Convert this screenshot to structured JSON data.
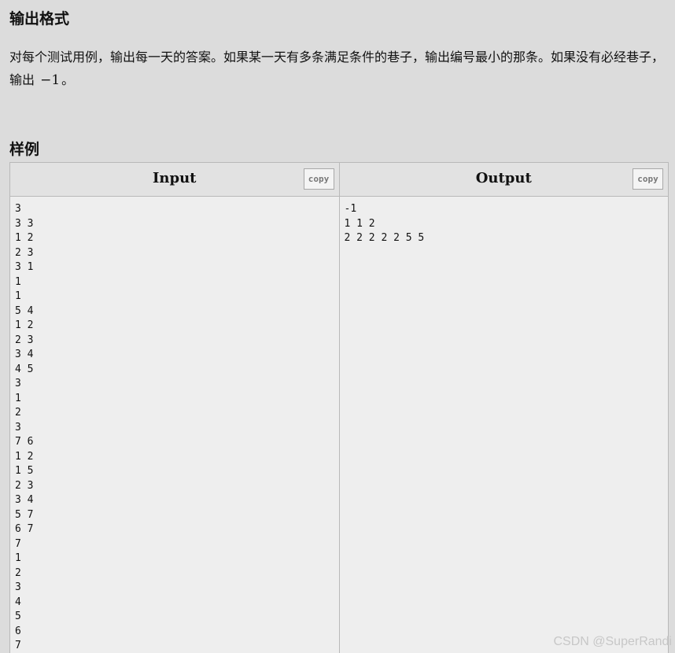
{
  "output_format": {
    "title": "输出格式",
    "desc_before": "对每个测试用例，输出每一天的答案。如果某一天有多条满足条件的巷子，输出编号最小的那条。如果没有必经巷子，输出 ",
    "desc_math": "−1",
    "desc_after": "。"
  },
  "samples": {
    "title": "样例",
    "input": {
      "label": "Input",
      "copy_label": "copy",
      "lines": [
        "3",
        "3 3",
        "1 2",
        "2 3",
        "3 1",
        "1",
        "1",
        "5 4",
        "1 2",
        "2 3",
        "3 4",
        "4 5",
        "3",
        "1",
        "2",
        "3",
        "7 6",
        "1 2",
        "1 5",
        "2 3",
        "3 4",
        "5 7",
        "6 7",
        "7",
        "1",
        "2",
        "3",
        "4",
        "5",
        "6",
        "7"
      ]
    },
    "output": {
      "label": "Output",
      "copy_label": "copy",
      "lines": [
        "-1",
        "1 1 2",
        "2 2 2 2 2 5 5"
      ]
    }
  },
  "watermark": "CSDN @SuperRandi"
}
